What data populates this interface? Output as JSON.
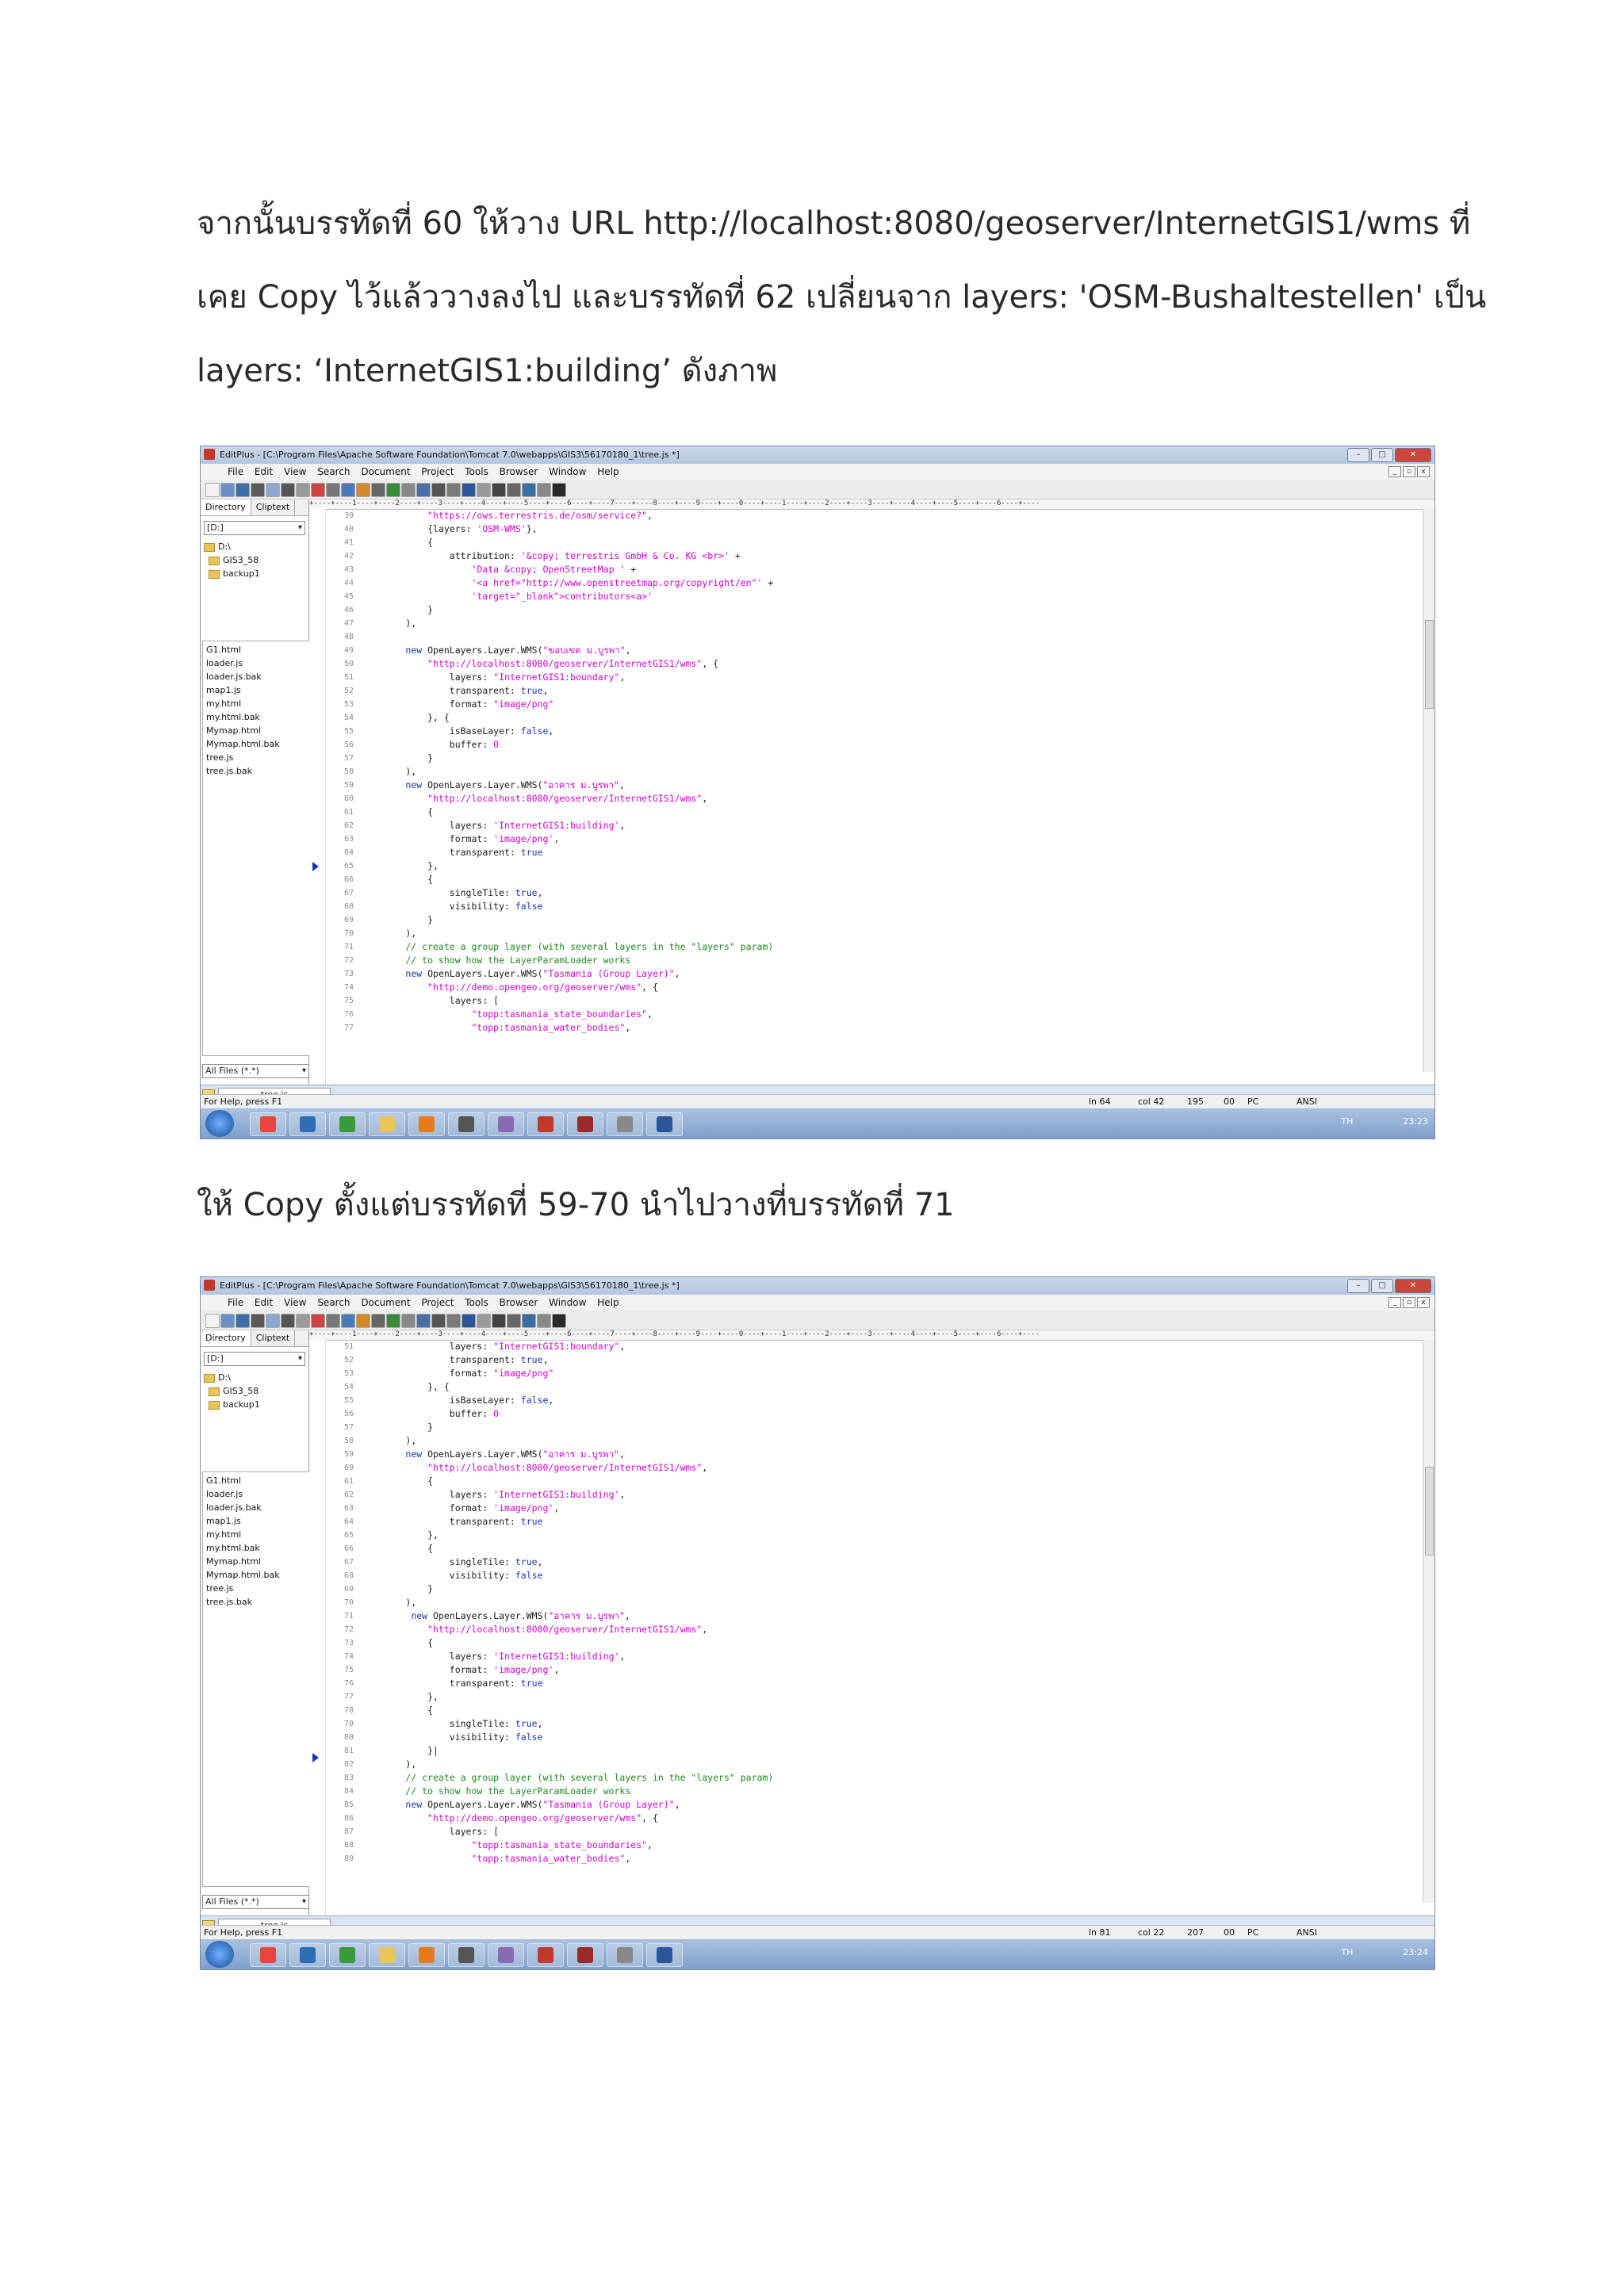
{
  "paragraphs": {
    "p1_line1": "จากนั้นบรรทัดที่ 60 ให้วาง URL http://localhost:8080/geoserver/InternetGIS1/wms  ที่",
    "p1_line2": "เคย Copy ไว้แล้ววางลงไป และบรรทัดที่ 62 เปลี่ยนจาก layers: 'OSM-Bushaltestellen' เป็น",
    "p1_line3": "layers: ‘InternetGIS1:building’  ดังภาพ",
    "p2": "ให้ Copy ตั้งแต่บรรทัดที่ 59-70 นำไปวางที่บรรทัดที่ 71"
  },
  "editor": {
    "title": "EditPlus - [C:\\Program Files\\Apache Software Foundation\\Tomcat 7.0\\webapps\\GIS3\\56170180_1\\tree.js *]",
    "menu": [
      "File",
      "Edit",
      "View",
      "Search",
      "Document",
      "Project",
      "Tools",
      "Browser",
      "Window",
      "Help"
    ],
    "sidebar_tabs": [
      "Directory",
      "Cliptext"
    ],
    "drive": "[D:]",
    "tree": [
      "D:\\",
      "GIS3_58",
      "backup1"
    ],
    "files": [
      "G1.html",
      "loader.js",
      "loader.js.bak",
      "map1.js",
      "my.html",
      "my.html.bak",
      "Mymap.html",
      "Mymap.html.bak",
      "tree.js",
      "tree.js.bak"
    ],
    "filter": "All Files (*.*)",
    "doc_tab": "tree.js",
    "status_help": "For Help, press F1",
    "ruler": "+----+----1----+----2----+----3----+----4----+----5----+----6----+----7----+----8----+----9----+----0----+----1----+----2----+----3----+----4----+----5----+----6----+----",
    "tray_lang": "TH"
  },
  "shot1": {
    "status": {
      "ln": "ln 64",
      "col": "col 42",
      "n": "195",
      "c": "00",
      "pc": "PC",
      "enc": "ANSI"
    },
    "clock": "23:23",
    "line_numbers": [
      "39",
      "40",
      "41",
      "42",
      "43",
      "44",
      "45",
      "46",
      "47",
      "48",
      "49",
      "50",
      "51",
      "52",
      "53",
      "54",
      "55",
      "56",
      "57",
      "58",
      "59",
      "60",
      "61",
      "62",
      "63",
      "64",
      "65",
      "66",
      "67",
      "68",
      "69",
      "70",
      "71",
      "72",
      "73",
      "74",
      "75",
      "76",
      "77"
    ],
    "lines": [
      "            \"https://ows.terrestris.de/osm/service?\",",
      "            {layers: 'OSM-WMS'},",
      "            {",
      "                attribution: '&copy; terrestris GmbH & Co. KG <br>' +",
      "                    'Data &copy; OpenStreetMap ' +",
      "                    '<a href=\"http://www.openstreetmap.org/copyright/en\"' +",
      "                    'target=\"_blank\">contributors<a>'",
      "            }",
      "        ),",
      "",
      "        new OpenLayers.Layer.WMS(\"ขอบเขต ม.บูรพา\",",
      "            \"http://localhost:8080/geoserver/InternetGIS1/wms\", {",
      "                layers: \"InternetGIS1:boundary\",",
      "                transparent: true,",
      "                format: \"image/png\"",
      "            }, {",
      "                isBaseLayer: false,",
      "                buffer: 0",
      "            }",
      "        ),",
      "        new OpenLayers.Layer.WMS(\"อาคาร ม.บูรพา\",",
      "            \"http://localhost:8080/geoserver/InternetGIS1/wms\",",
      "            {",
      "                layers: 'InternetGIS1:building',",
      "                format: 'image/png',",
      "                transparent: true",
      "            },",
      "            {",
      "                singleTile: true,",
      "                visibility: false",
      "            }",
      "        ),",
      "        // create a group layer (with several layers in the \"layers\" param)",
      "        // to show how the LayerParamLoader works",
      "        new OpenLayers.Layer.WMS(\"Tasmania (Group Layer)\",",
      "            \"http://demo.opengeo.org/geoserver/wms\", {",
      "                layers: [",
      "                    \"topp:tasmania_state_boundaries\",",
      "                    \"topp:tasmania_water_bodies\","
    ]
  },
  "shot2": {
    "status": {
      "ln": "ln 81",
      "col": "col 22",
      "n": "207",
      "c": "00",
      "pc": "PC",
      "enc": "ANSI"
    },
    "clock": "23:24",
    "line_numbers": [
      "51",
      "52",
      "53",
      "54",
      "55",
      "56",
      "57",
      "58",
      "59",
      "60",
      "61",
      "62",
      "63",
      "64",
      "65",
      "66",
      "67",
      "68",
      "69",
      "70",
      "71",
      "72",
      "73",
      "74",
      "75",
      "76",
      "77",
      "78",
      "79",
      "80",
      "81",
      "82",
      "83",
      "84",
      "85",
      "86",
      "87",
      "88",
      "89"
    ],
    "lines": [
      "                layers: \"InternetGIS1:boundary\",",
      "                transparent: true,",
      "                format: \"image/png\"",
      "            }, {",
      "                isBaseLayer: false,",
      "                buffer: 0",
      "            }",
      "        ),",
      "        new OpenLayers.Layer.WMS(\"อาคาร ม.บูรพา\",",
      "            \"http://localhost:8080/geoserver/InternetGIS1/wms\",",
      "            {",
      "                layers: 'InternetGIS1:building',",
      "                format: 'image/png',",
      "                transparent: true",
      "            },",
      "            {",
      "                singleTile: true,",
      "                visibility: false",
      "            }",
      "        ),",
      "         new OpenLayers.Layer.WMS(\"อาคาร ม.บูรพา\",",
      "            \"http://localhost:8080/geoserver/InternetGIS1/wms\",",
      "            {",
      "                layers: 'InternetGIS1:building',",
      "                format: 'image/png',",
      "                transparent: true",
      "            },",
      "            {",
      "                singleTile: true,",
      "                visibility: false",
      "            }|",
      "        ),",
      "        // create a group layer (with several layers in the \"layers\" param)",
      "        // to show how the LayerParamLoader works",
      "        new OpenLayers.Layer.WMS(\"Tasmania (Group Layer)\",",
      "            \"http://demo.opengeo.org/geoserver/wms\", {",
      "                layers: [",
      "                    \"topp:tasmania_state_boundaries\",",
      "                    \"topp:tasmania_water_bodies\","
    ]
  }
}
